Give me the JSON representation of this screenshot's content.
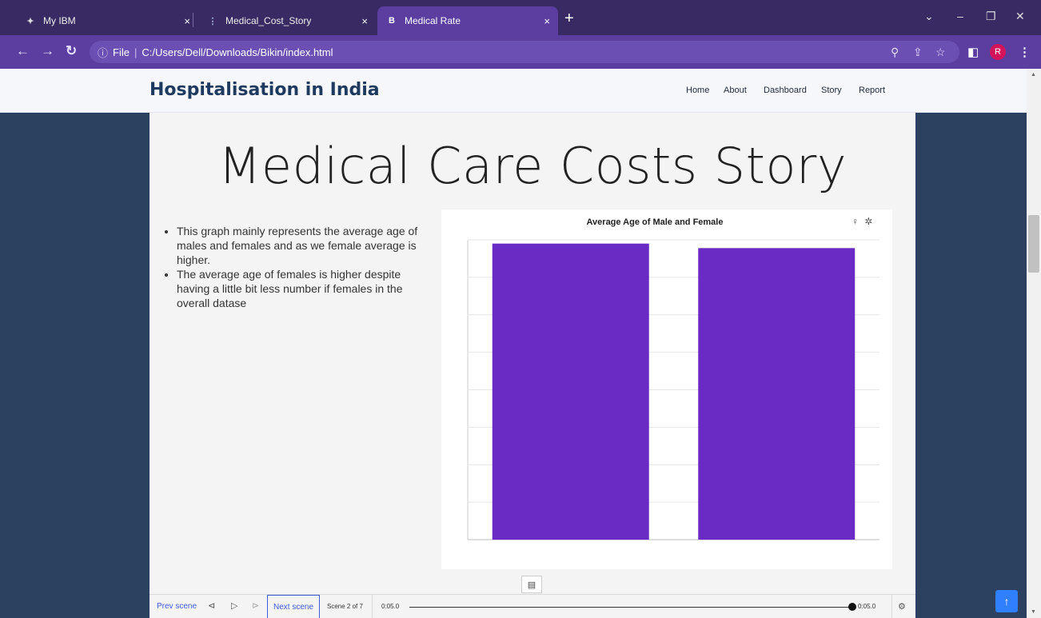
{
  "browser": {
    "tabs": [
      {
        "label": "My IBM",
        "icon": "ibm-bee-icon"
      },
      {
        "label": "Medical_Cost_Story",
        "icon": "cognos-icon"
      },
      {
        "label": "Medical Rate",
        "icon": "bootstrap-icon",
        "badge": "B"
      }
    ],
    "close_glyph": "×",
    "url_scheme": "File",
    "url": "C:/Users/Dell/Downloads/Bikin/index.html",
    "avatar_letter": "R"
  },
  "site": {
    "title": "Hospitalisation in India",
    "nav": [
      "Home",
      "About",
      "Dashboard",
      "Story",
      "Report"
    ]
  },
  "story": {
    "title": "Medical Care Costs Story",
    "notes": [
      "This graph mainly represents  the average age of males and females and as we female average is higher.",
      "The average age of females is higher despite having a little bit less number if females in the overall datase"
    ]
  },
  "chart_data": {
    "type": "bar",
    "title": "Average Age of Male and Female",
    "categories": [
      "",
      ""
    ],
    "values": [
      39.5,
      38.9
    ],
    "ylim": [
      0,
      40
    ],
    "grid": true,
    "bar_color": "#6a2bc4"
  },
  "player": {
    "prev": "Prev scene",
    "next": "Next scene",
    "scene": "Scene 2 of 7",
    "time_start": "0:05.0",
    "time_end": "0:05.0"
  },
  "colors": {
    "accent": "#5b3ea0",
    "page_bg": "#2c4160",
    "bar": "#6a2bc4"
  }
}
